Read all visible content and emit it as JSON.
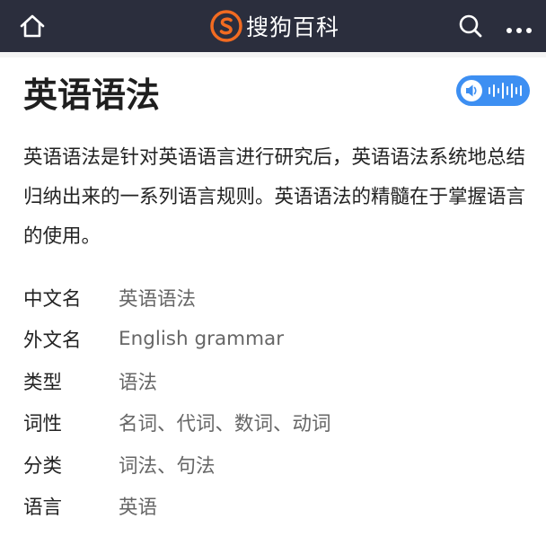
{
  "header": {
    "logo_text": "搜狗百科",
    "icons": [
      "home-icon",
      "sogou-logo-icon",
      "search-icon",
      "more-icon"
    ],
    "background_color": "#2b2e3d",
    "accent_color": "#f26b21"
  },
  "entry": {
    "title": "英语语法",
    "audio_icon": "speaker-icon",
    "audio_color": "#3d8ff2",
    "summary": "英语语法是针对英语语言进行研究后，英语语法系统地总结归纳出来的一系列语言规则。英语语法的精髓在于掌握语言的使用。"
  },
  "infobox": [
    {
      "label": "中文名",
      "value": "英语语法"
    },
    {
      "label": "外文名",
      "value": "English grammar"
    },
    {
      "label": "类型",
      "value": "语法"
    },
    {
      "label": "词性",
      "value": "名词、代词、数词、动词"
    },
    {
      "label": "分类",
      "value": "词法、句法"
    },
    {
      "label": "语言",
      "value": "英语"
    }
  ]
}
